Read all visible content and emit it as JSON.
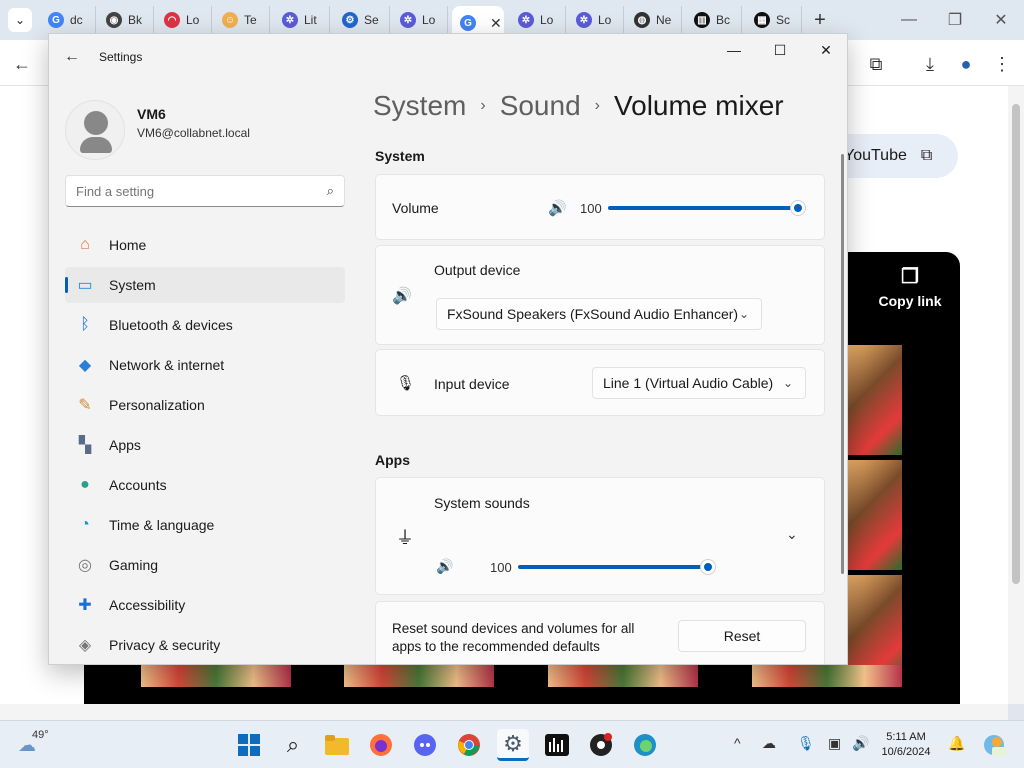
{
  "browser": {
    "tabs": [
      {
        "label": "dc",
        "favicon": "G",
        "color": "#4285f4"
      },
      {
        "label": "Bk",
        "favicon": "◉",
        "color": "#444444"
      },
      {
        "label": "Lo",
        "favicon": "◠",
        "color": "#d34"
      },
      {
        "label": "Te",
        "favicon": "☺",
        "color": "#f0b050"
      },
      {
        "label": "Lit",
        "favicon": "✲",
        "color": "#5b5bd6"
      },
      {
        "label": "Se",
        "favicon": "⚙",
        "color": "#2266cc"
      },
      {
        "label": "Lo",
        "favicon": "✲",
        "color": "#5b5bd6"
      },
      {
        "label": "",
        "favicon": "G",
        "color": "#4285f4"
      },
      {
        "label": "Lo",
        "favicon": "✲",
        "color": "#5b5bd6"
      },
      {
        "label": "Lo",
        "favicon": "✲",
        "color": "#5b5bd6"
      },
      {
        "label": "Ne",
        "favicon": "◍",
        "color": "#333333"
      },
      {
        "label": "Bc",
        "favicon": "▥",
        "color": "#111111"
      },
      {
        "label": "Sc",
        "favicon": "▦",
        "color": "#111111"
      }
    ],
    "new_tab": "+",
    "window": {
      "minimize": "—",
      "maximize": "❐",
      "close": "✕"
    },
    "toolbar": {
      "back": "←",
      "extensions": "⧉",
      "download": "⤓",
      "profile": "●",
      "menu": "⋮"
    }
  },
  "page": {
    "share_label": "YouTube",
    "share_icon": "⧉",
    "copy_link": "Copy link",
    "copy_icon": "❐"
  },
  "settings": {
    "app_title": "Settings",
    "back": "←",
    "window": {
      "minimize": "—",
      "maximize": "☐",
      "close": "✕"
    },
    "user": {
      "name": "VM6",
      "email": "VM6@collabnet.local"
    },
    "search": {
      "placeholder": "Find a setting",
      "icon": "⌕"
    },
    "nav": [
      {
        "label": "Home",
        "icon": "⌂",
        "color": "#e07a3a"
      },
      {
        "label": "System",
        "icon": "▭",
        "color": "#1a8fd6"
      },
      {
        "label": "Bluetooth & devices",
        "icon": "ᛒ",
        "color": "#1a6fd6"
      },
      {
        "label": "Network & internet",
        "icon": "◆",
        "color": "#2a7fd6"
      },
      {
        "label": "Personalization",
        "icon": "✎",
        "color": "#d0893a"
      },
      {
        "label": "Apps",
        "icon": "▚",
        "color": "#5a6a8a"
      },
      {
        "label": "Accounts",
        "icon": "●",
        "color": "#2aa08a"
      },
      {
        "label": "Time & language",
        "icon": "◔",
        "color": "#1a8fd6"
      },
      {
        "label": "Gaming",
        "icon": "◎",
        "color": "#777777"
      },
      {
        "label": "Accessibility",
        "icon": "✚",
        "color": "#1a6fd6"
      },
      {
        "label": "Privacy & security",
        "icon": "◈",
        "color": "#777777"
      }
    ],
    "selected_nav": "System",
    "breadcrumb": {
      "part1": "System",
      "part2": "Sound",
      "current": "Volume mixer",
      "sep": "›"
    },
    "system_section": {
      "title": "System",
      "volume": {
        "label": "Volume",
        "value": "100",
        "level": 1.0,
        "icon": "🔊"
      },
      "output": {
        "label": "Output device",
        "value": "FxSound Speakers (FxSound Audio Enhancer)",
        "icon": "🔊"
      },
      "input": {
        "label": "Input device",
        "value": "Line 1 (Virtual Audio Cable)",
        "icon": "🎙"
      }
    },
    "apps_section": {
      "title": "Apps",
      "system_sounds": {
        "label": "System sounds",
        "value": "100",
        "level": 1.0,
        "icon": "🔊",
        "app_icon": "⏚"
      }
    },
    "reset": {
      "text": "Reset sound devices and volumes for all apps to the recommended defaults",
      "button": "Reset"
    },
    "chevron": "⌄"
  },
  "taskbar": {
    "weather": "49°",
    "clock": {
      "time": "5:11 AM",
      "date": "10/6/2024"
    },
    "tray": {
      "chevron": "^",
      "onedrive": "☁",
      "mic": "🎙",
      "display": "▣",
      "speaker": "🔊",
      "bell": "🔔"
    }
  }
}
